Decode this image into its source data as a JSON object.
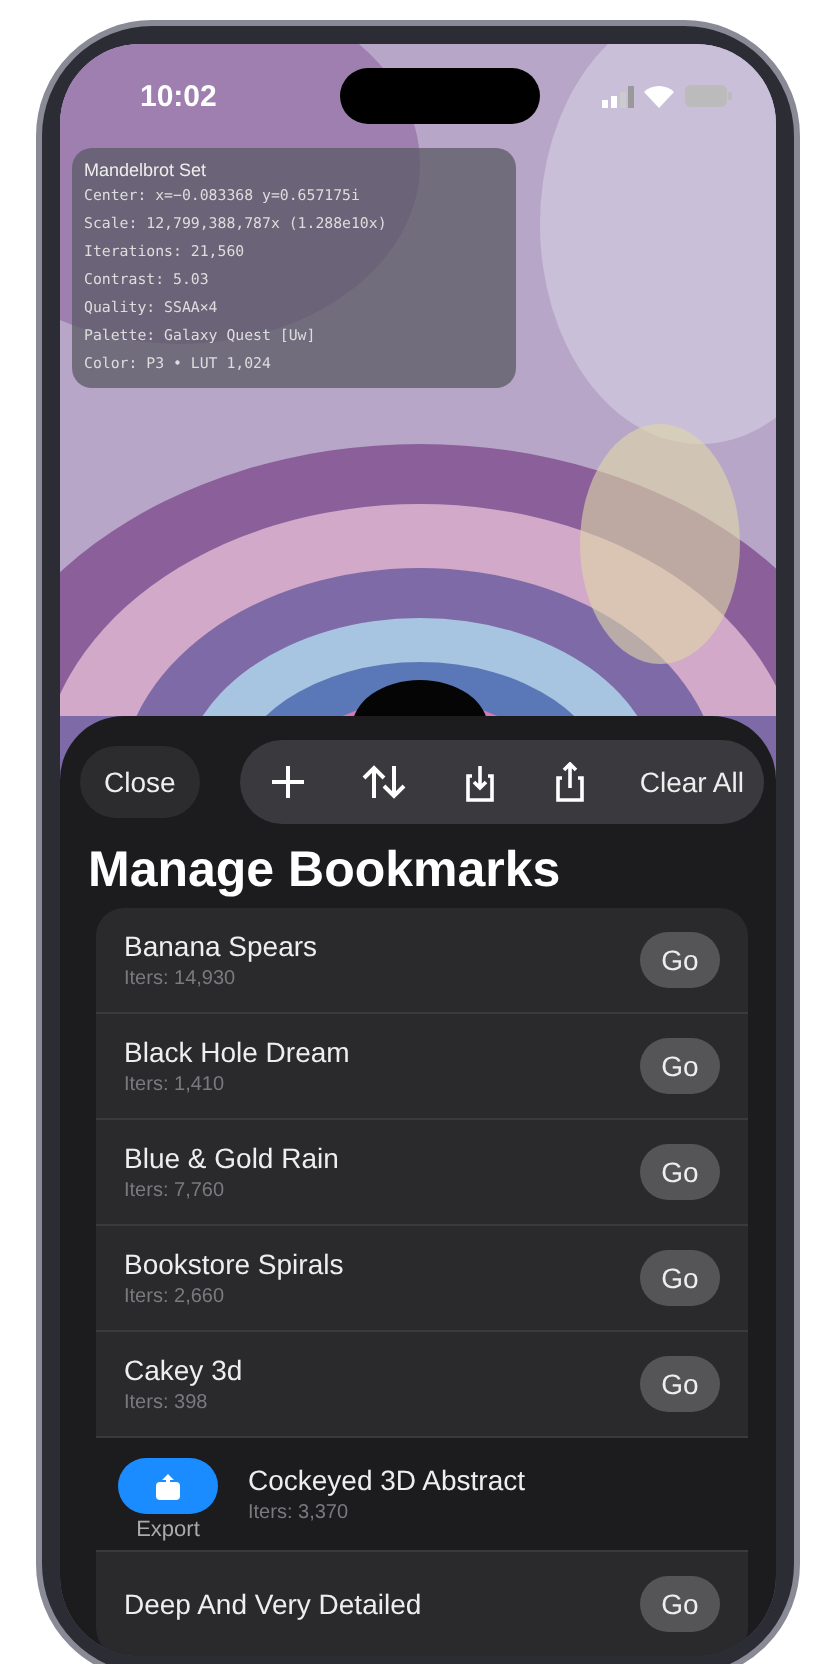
{
  "status_bar": {
    "time": "10:02"
  },
  "info_panel": {
    "title": "Mandelbrot Set",
    "lines": [
      "Center: x=−0.083368 y=0.657175i",
      "Scale: 12,799,388,787x  (1.288e10x)",
      "Iterations: 21,560",
      "Contrast: 5.03",
      "Quality: SSAA×4",
      "Palette: Galaxy Quest [Uw]",
      "Color: P3 • LUT 1,024"
    ]
  },
  "sheet": {
    "close": "Close",
    "toolbar": {
      "clear": "Clear All"
    },
    "title": "Manage Bookmarks",
    "rows": [
      {
        "kind": "normal",
        "name": "Banana Spears",
        "iters": "Iters: 14,930",
        "go": "Go"
      },
      {
        "kind": "normal",
        "name": "Black Hole Dream",
        "iters": "Iters: 1,410",
        "go": "Go"
      },
      {
        "kind": "normal",
        "name": "Blue & Gold Rain",
        "iters": "Iters: 7,760",
        "go": "Go"
      },
      {
        "kind": "normal",
        "name": "Bookstore Spirals",
        "iters": "Iters: 2,660",
        "go": "Go"
      },
      {
        "kind": "normal",
        "name": "Cakey 3d",
        "iters": "Iters: 398",
        "go": "Go"
      },
      {
        "kind": "swiped",
        "name": "Cockeyed 3D Abstract",
        "iters": "Iters: 3,370",
        "action": "Export"
      },
      {
        "kind": "normal",
        "name": "Deep And Very Detailed",
        "go": "Go"
      }
    ]
  }
}
